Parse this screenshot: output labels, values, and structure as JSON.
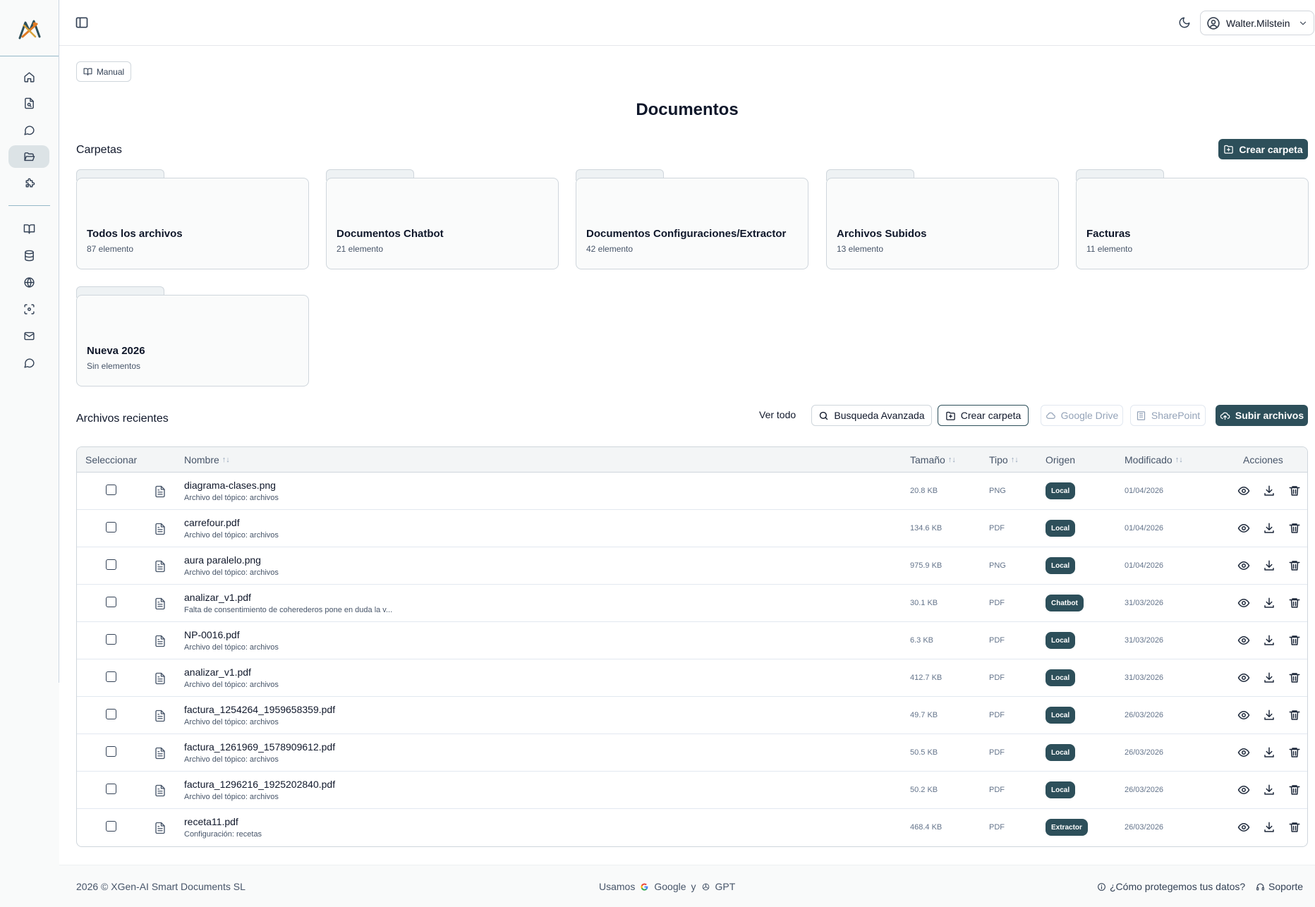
{
  "user": {
    "name": "Walter.Milstein"
  },
  "manual_label": "Manual",
  "page_title": "Documentos",
  "folders_section": {
    "label": "Carpetas",
    "create_label": "Crear carpeta",
    "folders": [
      {
        "name": "Todos los archivos",
        "count": "87 elemento"
      },
      {
        "name": "Documentos Chatbot",
        "count": "21 elemento"
      },
      {
        "name": "Documentos Configuraciones/Extractor",
        "count": "42 elemento"
      },
      {
        "name": "Archivos Subidos",
        "count": "13 elemento"
      },
      {
        "name": "Facturas",
        "count": "11 elemento"
      },
      {
        "name": "Nueva 2026",
        "count": "Sin elementos"
      }
    ]
  },
  "recent": {
    "label": "Archivos recientes",
    "view_all": "Ver todo",
    "advanced_search": "Busqueda Avanzada",
    "create_folder": "Crear carpeta",
    "google_drive": "Google Drive",
    "sharepoint": "SharePoint",
    "upload": "Subir archivos"
  },
  "table": {
    "headers": {
      "select": "Seleccionar",
      "name": "Nombre",
      "size": "Tamaño",
      "type": "Tipo",
      "origin": "Origen",
      "modified": "Modificado",
      "actions": "Acciones"
    },
    "sort_glyph": "↑↓",
    "rows": [
      {
        "name": "diagrama-clases.png",
        "sub": "Archivo del tópico: archivos",
        "size": "20.8 KB",
        "type": "PNG",
        "origin": "Local",
        "modified": "01/04/2026"
      },
      {
        "name": "carrefour.pdf",
        "sub": "Archivo del tópico: archivos",
        "size": "134.6 KB",
        "type": "PDF",
        "origin": "Local",
        "modified": "01/04/2026"
      },
      {
        "name": "aura paralelo.png",
        "sub": "Archivo del tópico: archivos",
        "size": "975.9 KB",
        "type": "PNG",
        "origin": "Local",
        "modified": "01/04/2026"
      },
      {
        "name": "analizar_v1.pdf",
        "sub": "Falta de consentimiento de coherederos pone en duda la v...",
        "size": "30.1 KB",
        "type": "PDF",
        "origin": "Chatbot",
        "modified": "31/03/2026"
      },
      {
        "name": "NP-0016.pdf",
        "sub": "Archivo del tópico: archivos",
        "size": "6.3 KB",
        "type": "PDF",
        "origin": "Local",
        "modified": "31/03/2026"
      },
      {
        "name": "analizar_v1.pdf",
        "sub": "Archivo del tópico: archivos",
        "size": "412.7 KB",
        "type": "PDF",
        "origin": "Local",
        "modified": "31/03/2026"
      },
      {
        "name": "factura_1254264_1959658359.pdf",
        "sub": "Archivo del tópico: archivos",
        "size": "49.7 KB",
        "type": "PDF",
        "origin": "Local",
        "modified": "26/03/2026"
      },
      {
        "name": "factura_1261969_1578909612.pdf",
        "sub": "Archivo del tópico: archivos",
        "size": "50.5 KB",
        "type": "PDF",
        "origin": "Local",
        "modified": "26/03/2026"
      },
      {
        "name": "factura_1296216_1925202840.pdf",
        "sub": "Archivo del tópico: archivos",
        "size": "50.2 KB",
        "type": "PDF",
        "origin": "Local",
        "modified": "26/03/2026"
      },
      {
        "name": "receta11.pdf",
        "sub": "Configuración: recetas",
        "size": "468.4 KB",
        "type": "PDF",
        "origin": "Extractor",
        "modified": "26/03/2026"
      }
    ]
  },
  "footer": {
    "copyright": "2026 © XGen-AI Smart Documents SL",
    "usamos": "Usamos",
    "google": "Google",
    "y": "y",
    "gpt": "GPT",
    "privacy": "¿Cómo protegemos tus datos?",
    "support": "Soporte"
  },
  "colors": {
    "accent": "#2d4f5a",
    "border": "#cfd6dc",
    "sidebar_bg": "#f9fafa"
  },
  "icons": {
    "sidebar": [
      "home-icon",
      "file-search-icon",
      "chat-bubble-icon",
      "folder-open-icon",
      "puzzle-icon",
      "book-open-icon",
      "database-icon",
      "globe-icon",
      "scan-icon",
      "mail-icon",
      "message-circle-icon"
    ],
    "row_actions": [
      "eye-icon",
      "download-icon",
      "trash-icon"
    ]
  }
}
